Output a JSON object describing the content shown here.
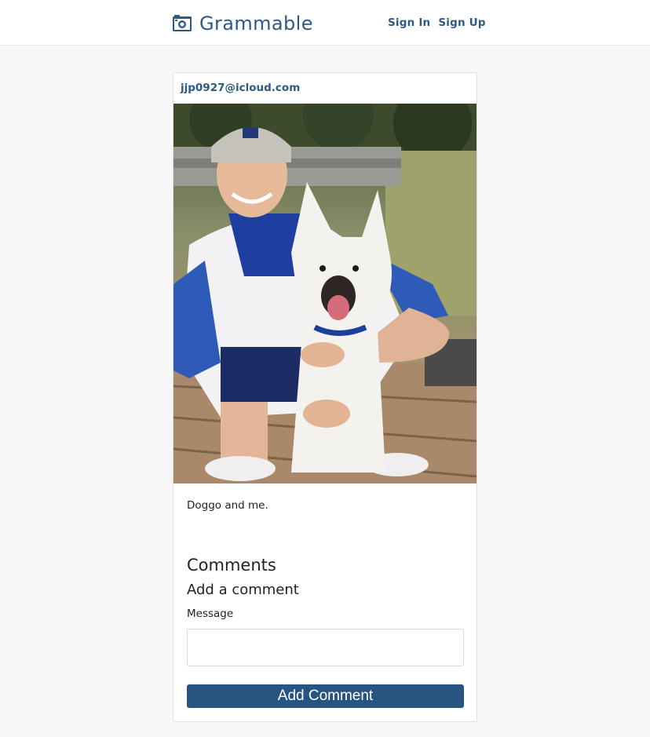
{
  "header": {
    "brand": "Grammable",
    "brand_icon": "camera-icon",
    "nav": {
      "sign_in": "Sign In",
      "sign_up": "Sign Up"
    },
    "accent_color": "#2c5a85"
  },
  "post": {
    "user_email": "jjp0927@icloud.com",
    "photo_alt": "Doggo and me.",
    "caption": "Doggo and me."
  },
  "comments": {
    "title": "Comments",
    "form_title": "Add a comment",
    "message_label": "Message",
    "message_value": "",
    "submit_label": "Add Comment",
    "button_color": "#285482"
  }
}
